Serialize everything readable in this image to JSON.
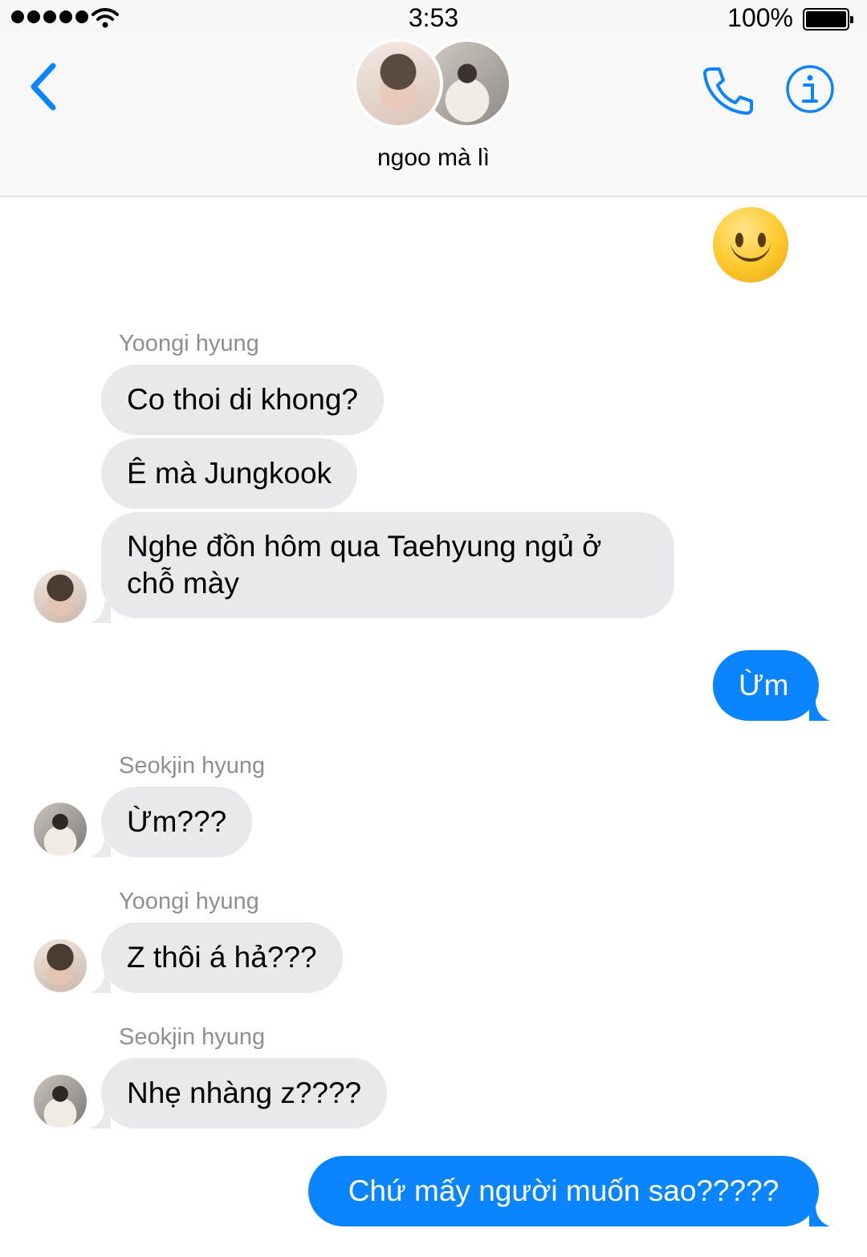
{
  "status_bar": {
    "time": "3:53",
    "battery": "100%"
  },
  "header": {
    "group_name": "ngoo mà lì",
    "icons": [
      "chevron-left-icon",
      "phone-icon",
      "info-icon"
    ],
    "accent_color": "#0a84ff"
  },
  "messages": [
    {
      "type": "emoji",
      "side": "out",
      "emoji": "🙂"
    },
    {
      "sender": "Yoongi hyung",
      "side": "in",
      "text": "Co thoi di khong?"
    },
    {
      "side": "in",
      "text": "Ê mà Jungkook"
    },
    {
      "side": "in",
      "text": "Nghe đồn hôm qua Taehyung ngủ ở chỗ mày"
    },
    {
      "side": "out",
      "text": "Ừm"
    },
    {
      "sender": "Seokjin hyung",
      "side": "in",
      "text": "Ừm???"
    },
    {
      "sender": "Yoongi hyung",
      "side": "in",
      "text": "Z thôi á hả???"
    },
    {
      "sender": "Seokjin hyung",
      "side": "in",
      "text": "Nhẹ nhàng z????"
    },
    {
      "side": "out",
      "text": "Chứ mấy người muốn sao?????"
    }
  ]
}
